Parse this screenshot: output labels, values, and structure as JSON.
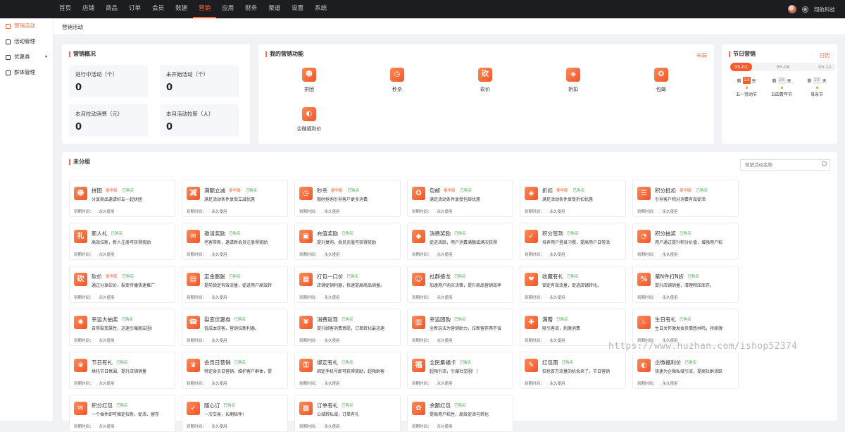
{
  "topnav": [
    "首页",
    "店铺",
    "商品",
    "订单",
    "会员",
    "数据",
    "营销",
    "应用",
    "财务",
    "渠道",
    "设置",
    "系统"
  ],
  "topnav_active": 6,
  "user": {
    "name": "翔航科技"
  },
  "sidebar": [
    {
      "label": "营销活动",
      "icon": "tag-icon",
      "active": true
    },
    {
      "label": "活动管理",
      "icon": "list-icon"
    },
    {
      "label": "优惠券",
      "icon": "coupon-icon",
      "caret": "▾"
    },
    {
      "label": "群体管理",
      "icon": "group-icon"
    }
  ],
  "breadcrumb": "营销活动",
  "overview": {
    "title": "营销概况",
    "stats": [
      {
        "label": "进行中活动（个）",
        "value": "0"
      },
      {
        "label": "未开始活动（个）",
        "value": "0"
      },
      {
        "label": "本月拉动消费（元）",
        "value": "0"
      },
      {
        "label": "本月活动拉新（人）",
        "value": "0"
      }
    ]
  },
  "my_functions": {
    "title": "我的营销功能",
    "link": "布局",
    "items": [
      {
        "label": "拼团",
        "glyph": "☻"
      },
      {
        "label": "秒杀",
        "glyph": "◷"
      },
      {
        "label": "砍价",
        "glyph": "砍"
      },
      {
        "label": "折扣",
        "glyph": "◈"
      },
      {
        "label": "包邮",
        "glyph": "✪"
      },
      {
        "label": "企微福利价",
        "glyph": "◐"
      }
    ]
  },
  "festival": {
    "title": "节日营销",
    "link": "日历",
    "tabs": [
      "05-01",
      "05-04",
      "05-11"
    ],
    "active_tab": 0,
    "cards": [
      {
        "pre": "剩",
        "num": "13",
        "post": "天",
        "name": "五一劳动节",
        "hot": true
      },
      {
        "pre": "剩",
        "num": "16",
        "post": "天",
        "name": "五四青年节",
        "hot": false
      },
      {
        "pre": "剩",
        "num": "23",
        "post": "天",
        "name": "母亲节",
        "hot": false
      }
    ]
  },
  "ungrouped": {
    "title": "未分组",
    "search_placeholder": "营销活动名称",
    "expire_label": "到期时间：",
    "expire_value": "永久使用",
    "vip_tag": "豪华版",
    "bought_tag": "已购买",
    "tiles": [
      {
        "name": "拼团",
        "vip": true,
        "desc": "分享商品邀请好友一起拼团",
        "glyph": "☻"
      },
      {
        "name": "满额立减",
        "vip": true,
        "desc": "满足活动条件享受立减优惠",
        "glyph": "减"
      },
      {
        "name": "秒杀",
        "vip": true,
        "desc": "限时抢购引导客户更多消费",
        "glyph": "◷"
      },
      {
        "name": "包邮",
        "vip": true,
        "desc": "满足活动条件享受包邮优惠",
        "glyph": "✪"
      },
      {
        "name": "折扣",
        "vip": true,
        "desc": "满足活动条件享受折扣优惠",
        "glyph": "◈"
      },
      {
        "name": "积分抵扣",
        "vip": true,
        "desc": "引导客户积分消费有效促活",
        "glyph": "☰"
      },
      {
        "name": "新人礼",
        "vip": false,
        "desc": "高效拉新，新人注册可获得奖励",
        "glyph": "礼"
      },
      {
        "name": "邀请奖励",
        "vip": false,
        "desc": "老客带新，邀请新会员注册得奖励",
        "glyph": "✉"
      },
      {
        "name": "充值奖励",
        "vip": false,
        "desc": "提升复购，会员充值可获得奖励",
        "glyph": "▣"
      },
      {
        "name": "消费奖励",
        "vip": false,
        "desc": "促进活跃，用户消费满额或满次获得",
        "glyph": "◆"
      },
      {
        "name": "积分签到",
        "vip": false,
        "desc": "培养用户登录习惯，提高用户日常活",
        "glyph": "✓"
      },
      {
        "name": "积分抽奖",
        "vip": false,
        "desc": "用户通过提升积分价值，增强用户粘",
        "glyph": "◔"
      },
      {
        "name": "砍价",
        "vip": true,
        "desc": "通过分享砍价，裂变传播快速推广",
        "glyph": "砍"
      },
      {
        "name": "定金膨胀",
        "vip": false,
        "desc": "提前锁定有效流量，促进用户高效转",
        "glyph": "▤"
      },
      {
        "name": "打包一口价",
        "vip": false,
        "desc": "店铺促销利器，快速提高商品销量。",
        "glyph": "▦"
      },
      {
        "name": "社群接龙",
        "vip": false,
        "desc": "加速用户购买决策，提升商品营销效率",
        "glyph": "☺"
      },
      {
        "name": "收藏有礼",
        "vip": false,
        "desc": "锁定有效流量，促进店铺转化。",
        "glyph": "❤"
      },
      {
        "name": "第N件打N折",
        "vip": false,
        "desc": "提升店铺销量，清理积压库存。",
        "glyph": "%"
      },
      {
        "name": "幸运大抽奖",
        "vip": false,
        "desc": "自带裂变属性，迅速引爆朋友圈!",
        "glyph": "✺"
      },
      {
        "name": "裂变优惠券",
        "vip": false,
        "desc": "低成本获客，营销拉新利器。",
        "glyph": "☎"
      },
      {
        "name": "消费返现",
        "vip": false,
        "desc": "提升顾客消费意愿，订单转化最迅速",
        "glyph": "¥"
      },
      {
        "name": "幸运团购",
        "vip": false,
        "desc": "全新玩法为营销助力，拉新留存两不误",
        "glyph": "▥"
      },
      {
        "name": "满赠",
        "vip": false,
        "desc": "吸引客流，刺激消费",
        "glyph": "✚"
      },
      {
        "name": "生日有礼",
        "vip": false,
        "desc": "生日关怀激发会员情感共鸣，持续激",
        "glyph": "♨"
      },
      {
        "name": "节日有礼",
        "vip": false,
        "desc": "烘托节日氛围，提升店铺销量",
        "glyph": "❀"
      },
      {
        "name": "会员日营销",
        "vip": false,
        "desc": "特定会员日营销，维护客户群体，提",
        "glyph": "♛"
      },
      {
        "name": "绑定有礼",
        "vip": false,
        "desc": "绑定手机号即可获得奖励，超强助客",
        "glyph": "⚿"
      },
      {
        "name": "全民集福卡",
        "vip": false,
        "desc": "超强引流，引爆社交圈！！",
        "glyph": "福"
      },
      {
        "name": "红包雨",
        "vip": false,
        "desc": "狂抢百万流量的机会来了，节日营销",
        "glyph": "✎"
      },
      {
        "name": "企微福利价",
        "vip": false,
        "desc": "快速为企微私域引流，提高社群活跃",
        "glyph": "◐"
      },
      {
        "name": "积分红包",
        "vip": false,
        "desc": "一个插件即可搞定拉新、促活、留存",
        "glyph": "✉"
      },
      {
        "name": "随心订",
        "vip": false,
        "desc": "一次交易，长期陪伴!",
        "glyph": "✓"
      },
      {
        "name": "订单有礼",
        "vip": false,
        "desc": "公域转私域，订单有礼",
        "glyph": "▩"
      },
      {
        "name": "余额红包",
        "vip": false,
        "desc": "提高用户粘性，高效促活与转化",
        "glyph": "✿"
      }
    ]
  },
  "watermark": "https://www.huzhan.com/ishop52374"
}
